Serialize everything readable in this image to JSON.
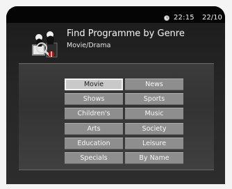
{
  "status": {
    "time": "22:15",
    "date": "22/10"
  },
  "header": {
    "title": "Find Programme by Genre",
    "subtitle": "Movie/Drama"
  },
  "genres": [
    {
      "label": "Movie",
      "selected": true
    },
    {
      "label": "News"
    },
    {
      "label": "Shows"
    },
    {
      "label": "Sports"
    },
    {
      "label": "Children's"
    },
    {
      "label": "Music"
    },
    {
      "label": "Arts"
    },
    {
      "label": "Society"
    },
    {
      "label": "Education"
    },
    {
      "label": "Leisure"
    },
    {
      "label": "Specials"
    },
    {
      "label": "By Name"
    }
  ],
  "icons": {
    "status": "clock-icon",
    "header": "genre-search-icon"
  }
}
